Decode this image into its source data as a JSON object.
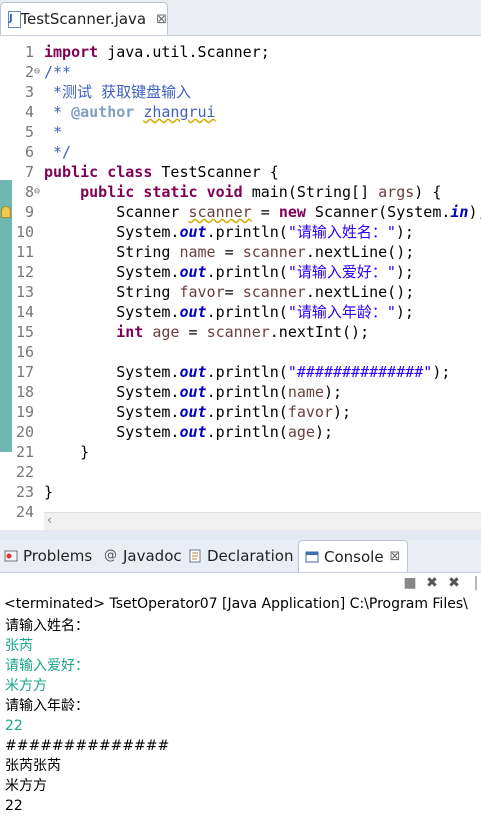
{
  "editor": {
    "tab_label": "TestScanner.java",
    "tab_close": "⊠",
    "lines": [
      {
        "n": "1",
        "fold": ""
      },
      {
        "n": "2",
        "fold": "⊖"
      },
      {
        "n": "3",
        "fold": ""
      },
      {
        "n": "4",
        "fold": ""
      },
      {
        "n": "5",
        "fold": ""
      },
      {
        "n": "6",
        "fold": ""
      },
      {
        "n": "7",
        "fold": ""
      },
      {
        "n": "8",
        "fold": "⊖"
      },
      {
        "n": "9",
        "fold": ""
      },
      {
        "n": "10",
        "fold": ""
      },
      {
        "n": "11",
        "fold": ""
      },
      {
        "n": "12",
        "fold": ""
      },
      {
        "n": "13",
        "fold": ""
      },
      {
        "n": "14",
        "fold": ""
      },
      {
        "n": "15",
        "fold": ""
      },
      {
        "n": "16",
        "fold": ""
      },
      {
        "n": "17",
        "fold": ""
      },
      {
        "n": "18",
        "fold": ""
      },
      {
        "n": "19",
        "fold": ""
      },
      {
        "n": "20",
        "fold": ""
      },
      {
        "n": "21",
        "fold": ""
      },
      {
        "n": "22",
        "fold": ""
      },
      {
        "n": "23",
        "fold": ""
      },
      {
        "n": "24",
        "fold": ""
      }
    ],
    "code": {
      "l1_kw": "import",
      "l1_rest": " java.util.Scanner;",
      "l2": "/**",
      "l3": " *测试 获取键盘输入",
      "l4_pre": " * ",
      "l4_tag": "@author",
      "l4_sp": " ",
      "l4_name": "zhangrui",
      "l5": " *",
      "l6": " */",
      "l7_kw1": "public",
      "l7_sp": " ",
      "l7_kw2": "class",
      "l7_rest": " TestScanner {",
      "l8_ind": "    ",
      "l8_kw1": "public",
      "l8_kw2": "static",
      "l8_kw3": "void",
      "l8_a": " main(String[] ",
      "l8_args": "args",
      "l8_b": ") {",
      "l9_a": "        Scanner ",
      "l9_var": "scanner",
      "l9_b": " = ",
      "l9_new": "new",
      "l9_c": " Scanner(System.",
      "l9_in": "in",
      "l9_d": ");",
      "l10_a": "        System.",
      "l10_out": "out",
      "l10_b": ".println(",
      "l10_s": "\"请输入姓名：\"",
      "l10_c": ");",
      "l11_a": "        String ",
      "l11_v": "name",
      "l11_b": " = ",
      "l11_v2": "scanner",
      "l11_c": ".nextLine();",
      "l12_a": "        System.",
      "l12_out": "out",
      "l12_b": ".println(",
      "l12_s": "\"请输入爱好：\"",
      "l12_c": ");",
      "l13_a": "        String ",
      "l13_v": "favor",
      "l13_b": "= ",
      "l13_v2": "scanner",
      "l13_c": ".nextLine();",
      "l14_a": "        System.",
      "l14_out": "out",
      "l14_b": ".println(",
      "l14_s": "\"请输入年龄：\"",
      "l14_c": ");",
      "l15_ind": "        ",
      "l15_kw": "int",
      "l15_a": " ",
      "l15_v": "age",
      "l15_b": " = ",
      "l15_v2": "scanner",
      "l15_c": ".nextInt();",
      "l17_a": "        System.",
      "l17_out": "out",
      "l17_b": ".println(",
      "l17_s": "\"##############\"",
      "l17_c": ");",
      "l18_a": "        System.",
      "l18_out": "out",
      "l18_b": ".println(",
      "l18_v": "name",
      "l18_c": ");",
      "l19_a": "        System.",
      "l19_out": "out",
      "l19_b": ".println(",
      "l19_v": "favor",
      "l19_c": ");",
      "l20_a": "        System.",
      "l20_out": "out",
      "l20_b": ".println(",
      "l20_v": "age",
      "l20_c": ");",
      "l21": "    }",
      "l23": "}"
    }
  },
  "views": {
    "tabs": [
      {
        "label": "Problems",
        "icon": "problems-icon"
      },
      {
        "label": "Javadoc",
        "icon": "javadoc-icon"
      },
      {
        "label": "Declaration",
        "icon": "declaration-icon"
      },
      {
        "label": "Console",
        "icon": "console-icon"
      }
    ],
    "close": "⊠"
  },
  "console": {
    "header": "<terminated> TsetOperator07 [Java Application] C:\\Program Files\\",
    "output": [
      {
        "text": "请输入姓名：",
        "kind": "sys"
      },
      {
        "text": "张芮",
        "kind": "in"
      },
      {
        "text": "请输入爱好：",
        "kind": "in"
      },
      {
        "text": "米方方",
        "kind": "in"
      },
      {
        "text": "请输入年龄：",
        "kind": "sys"
      },
      {
        "text": "22",
        "kind": "in"
      },
      {
        "text": "##############",
        "kind": "sys"
      },
      {
        "text": "张芮张芮",
        "kind": "sys"
      },
      {
        "text": "米方方",
        "kind": "sys"
      },
      {
        "text": "22",
        "kind": "sys"
      }
    ]
  },
  "colors": {
    "coverage": "#6fb8b2",
    "keyword": "#7f0055",
    "string": "#2a00ff",
    "comment": "#3f5fbf",
    "stdin": "#1aa58a"
  }
}
